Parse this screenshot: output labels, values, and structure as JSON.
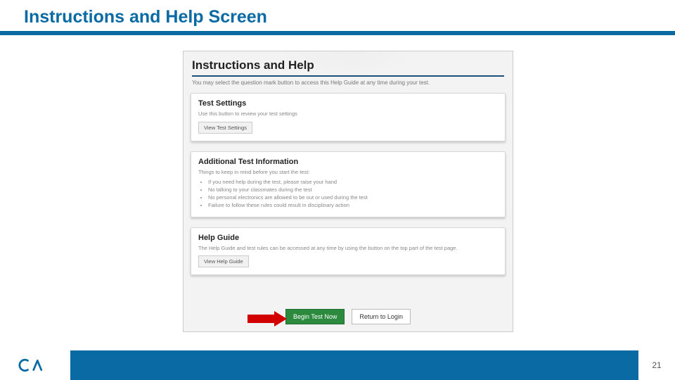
{
  "slide": {
    "title": "Instructions and Help Screen",
    "page_number": "21"
  },
  "shot": {
    "heading": "Instructions and Help",
    "subheading": "You may select the question mark button to access this Help Guide at any time during your test.",
    "panels": {
      "settings": {
        "title": "Test Settings",
        "desc": "Use this button to review your test settings",
        "button": "View Test Settings"
      },
      "info": {
        "title": "Additional Test Information",
        "lead": "Things to keep in mind before you start the test:",
        "items": [
          "If you need help during the test, please raise your hand",
          "No talking to your classmates during the test",
          "No personal electronics are allowed to be out or used during the test",
          "Failure to follow these rules could result in disciplinary action"
        ]
      },
      "help": {
        "title": "Help Guide",
        "desc": "The Help Guide and test rules can be accessed at any time by using the button on the top part of the test page.",
        "button": "View Help Guide"
      }
    },
    "actions": {
      "begin": "Begin Test Now",
      "return": "Return to Login"
    }
  }
}
